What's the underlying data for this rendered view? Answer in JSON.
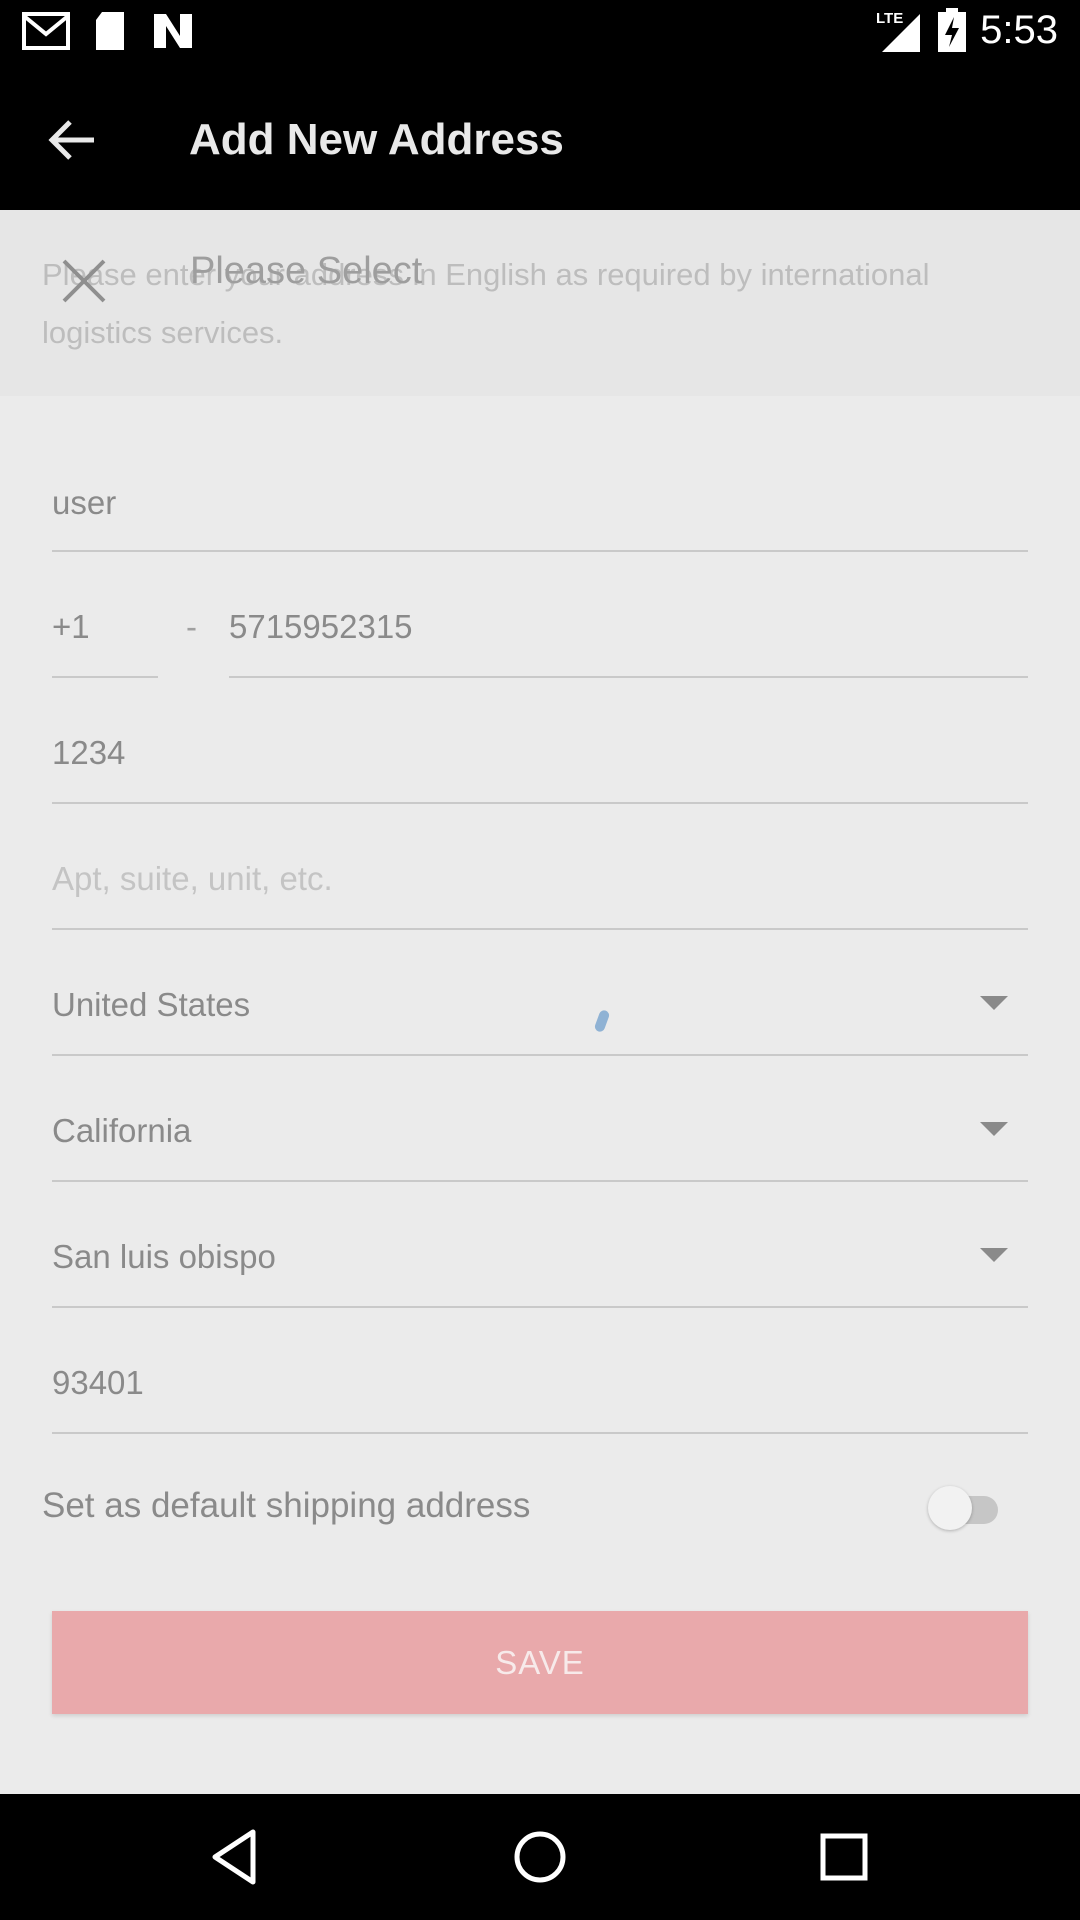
{
  "status_bar": {
    "time": "5:53",
    "network": "LTE",
    "icons": [
      "gmail-icon",
      "sd-card-icon",
      "n-logo-icon",
      "signal-icon",
      "battery-charging-icon"
    ]
  },
  "toolbar": {
    "title": "Add New Address",
    "back_icon": "arrow-back-icon"
  },
  "notice": {
    "text": "Please enter your address in English as required by international logistics services."
  },
  "overlay": {
    "title": "Please Select",
    "close_icon": "close-icon"
  },
  "form": {
    "name": "user",
    "phone_code": "+1",
    "phone_separator": "-",
    "phone_number": "5715952315",
    "address_line1": "1234",
    "address_line2_placeholder": "Apt, suite, unit, etc.",
    "country": "United States",
    "state": "California",
    "city": "San luis obispo",
    "zip": "93401",
    "default_label": "Set as default shipping address",
    "default_on": false,
    "save_label": "SAVE"
  },
  "colors": {
    "save_button": "#e9a9ab",
    "background": "#ebebeb"
  },
  "nav_bar": {
    "icons": [
      "back-triangle-icon",
      "home-circle-icon",
      "recents-square-icon"
    ]
  }
}
